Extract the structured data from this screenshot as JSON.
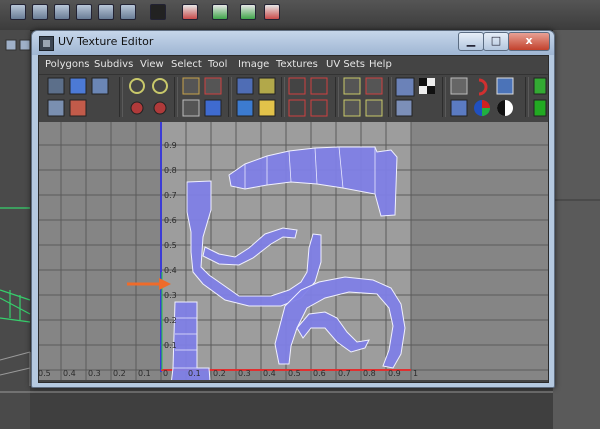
{
  "window": {
    "title": "UV Texture Editor",
    "minimize_glyph": "▁",
    "maximize_glyph": "□",
    "close_glyph": "x"
  },
  "menu": [
    "Polygons",
    "Subdivs",
    "View",
    "Select",
    "Tool",
    "Image",
    "Textures",
    "UV Sets",
    "Help"
  ],
  "grid": {
    "u_ticks": [
      "0.5",
      "0.4",
      "0.3",
      "0.2",
      "0.1",
      "0",
      "0.1",
      "0.2",
      "0.3",
      "0.4",
      "0.5",
      "0.6",
      "0.7",
      "0.8",
      "0.9",
      "1"
    ],
    "v_ticks": [
      "0.9",
      "0.8",
      "0.7",
      "0.6",
      "0.5",
      "0.4",
      "0.3",
      "0.2",
      "0.1"
    ]
  },
  "colors": {
    "uv_shell_fill": "#7f7fe6",
    "uv_shell_edge": "#f0f0ff",
    "u_axis": "#e03030",
    "v_axis": "#3b3bd6",
    "arrow": "#ef6b2a",
    "viewport_bg": "#858585",
    "tile_bg": "#9d9d9d"
  },
  "icons": [
    "checker-icon",
    "uv-lattice-icon",
    "shaded-uv-icon",
    "magnet-icon",
    "rgb-channels-icon",
    "alpha-channel-icon"
  ]
}
